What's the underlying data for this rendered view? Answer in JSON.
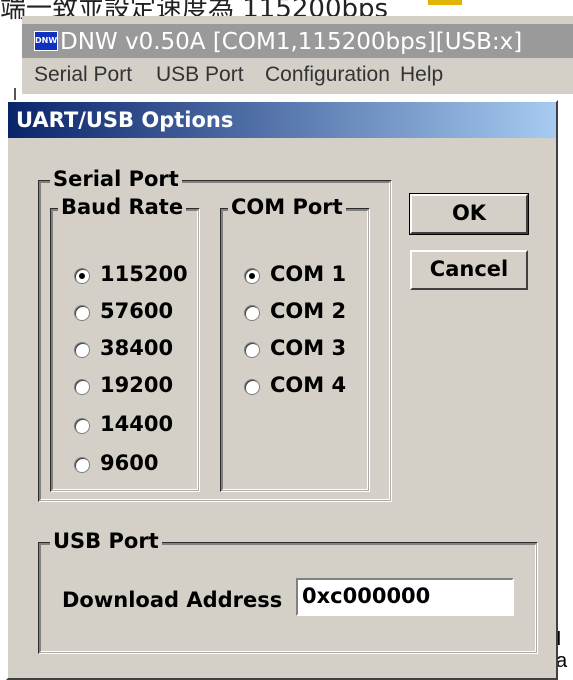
{
  "background": {
    "partial_text": "端一致並設定速度為 115200bps",
    "edge_glyphs": [
      "I",
      "a"
    ]
  },
  "app": {
    "icon_label": "DNW",
    "title": "DNW v0.50A   [COM1,115200bps][USB:x]",
    "menu": [
      "Serial Port",
      "USB Port",
      "Configuration",
      "Help"
    ]
  },
  "dialog": {
    "title": "UART/USB Options",
    "serial_port": {
      "legend": "Serial Port",
      "baud_rate": {
        "legend": "Baud Rate",
        "options": [
          "115200",
          "57600",
          "38400",
          "19200",
          "14400",
          "9600"
        ],
        "selected": "115200"
      },
      "com_port": {
        "legend": "COM Port",
        "options": [
          "COM 1",
          "COM 2",
          "COM 3",
          "COM 4"
        ],
        "selected": "COM 1"
      }
    },
    "buttons": {
      "ok": "OK",
      "cancel": "Cancel"
    },
    "usb_port": {
      "legend": "USB Port",
      "download_address_label": "Download Address",
      "download_address_value": "0xc000000"
    }
  },
  "colors": {
    "dialog_face": "#d4d0c8",
    "title_gradient_start": "#0a246a",
    "title_gradient_end": "#a6caf0"
  }
}
